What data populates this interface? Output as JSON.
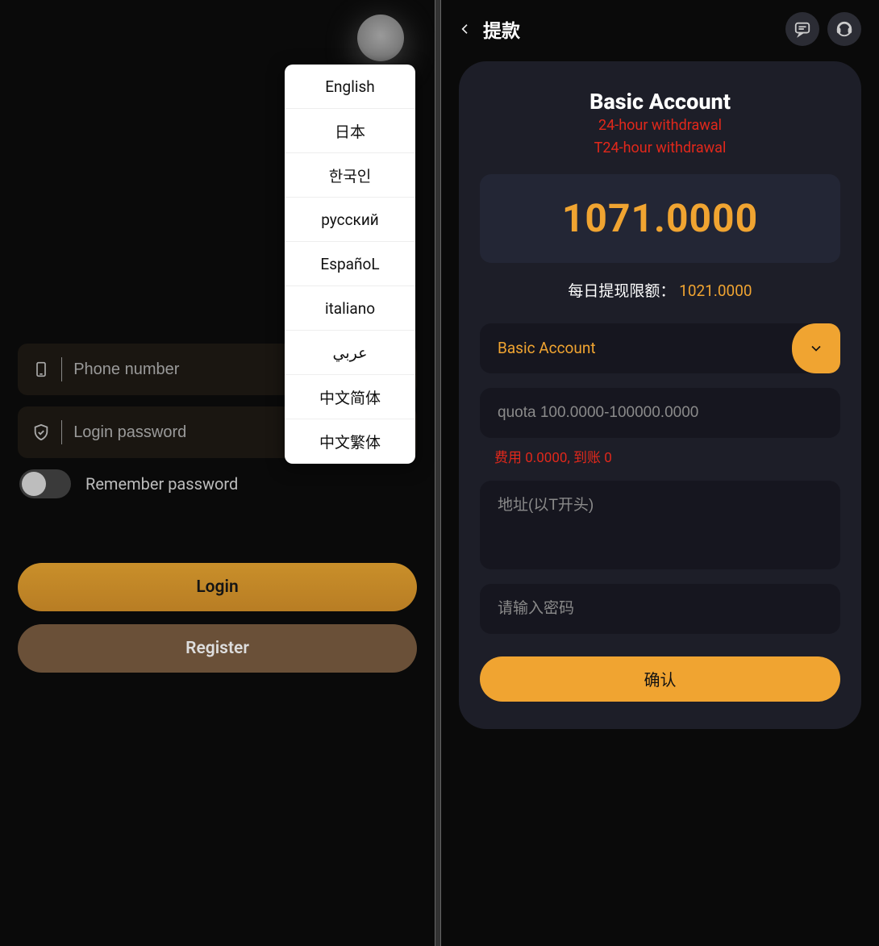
{
  "left": {
    "languages": [
      "English",
      "日本",
      "한국인",
      "русский",
      "EspañoL",
      "italiano",
      "عربي",
      "中文简体",
      "中文繁体"
    ],
    "phone_placeholder": "Phone number",
    "password_placeholder": "Login password",
    "remember_label": "Remember password",
    "login_label": "Login",
    "register_label": "Register"
  },
  "right": {
    "title": "提款",
    "account_title": "Basic Account",
    "note1": "24-hour withdrawal",
    "note2": "T24-hour withdrawal",
    "balance": "1071.0000",
    "daily_label": "每日提现限额：",
    "daily_value": "1021.0000",
    "select_label": "Basic Account",
    "quota_placeholder": "quota 100.0000-100000.0000",
    "fee_line": "费用 0.0000, 到账 0",
    "address_placeholder": "地址(以T开头)",
    "pwd_placeholder": "请输入密码",
    "confirm_label": "确认"
  }
}
